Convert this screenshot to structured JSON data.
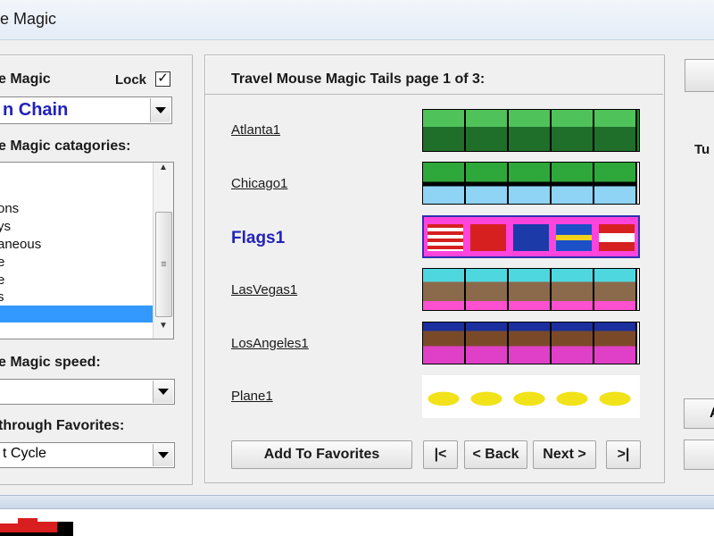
{
  "window": {
    "title": "e Magic"
  },
  "left": {
    "magic_label": "e Magic",
    "lock_label": "Lock",
    "lock_checked": "✓",
    "magic_value": "n Chain",
    "categories_label": "e Magic catagories:",
    "categories": [
      "ons",
      "ys",
      "aneous",
      "e",
      "e",
      "s",
      ""
    ],
    "speed_label": "e Magic speed:",
    "speed_value": "",
    "cycle_label": "through Favorites:",
    "cycle_value": "t Cycle"
  },
  "center": {
    "header": "Travel Mouse Magic Tails page 1 of 3:",
    "tails": [
      {
        "name": "Atlanta1",
        "current": false
      },
      {
        "name": "Chicago1",
        "current": false
      },
      {
        "name": "Flags1",
        "current": true
      },
      {
        "name": "LasVegas1",
        "current": false
      },
      {
        "name": "LosAngeles1",
        "current": false
      },
      {
        "name": "Plane1",
        "current": false
      }
    ],
    "add_favorites": "Add To Favorites",
    "first": "|<",
    "back": "< Back",
    "next": "Next >",
    "last": ">|"
  },
  "right": {
    "partial_label": "Tu",
    "partial_button": "A"
  },
  "colors": {
    "accent": "#3399ff",
    "current_tail": "#2222bb",
    "selected_frame": "#2f2fb0"
  },
  "icons": [
    "dropdown-arrow-icon",
    "scroll-up-icon",
    "scroll-down-icon",
    "check-icon"
  ]
}
